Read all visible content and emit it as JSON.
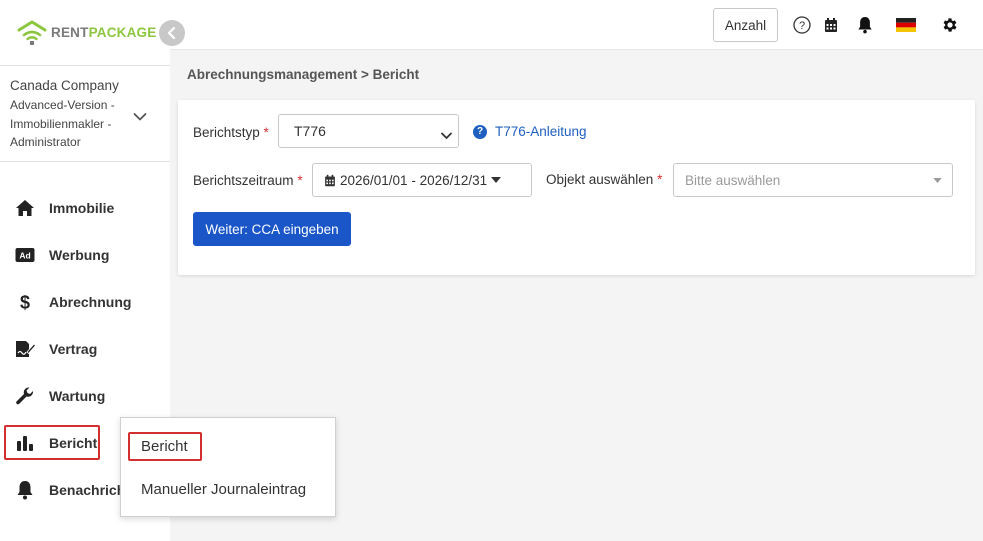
{
  "brand": {
    "rent": "RENT",
    "package": "PACKAGE",
    "accent": "#8cc63f"
  },
  "company": {
    "name": "Canada Company",
    "subtitle": "Advanced-Version - Immobilienmakler - Administrator"
  },
  "sidebar": {
    "items": [
      {
        "label": "Immobilie",
        "icon": "home-icon"
      },
      {
        "label": "Werbung",
        "icon": "ad-icon"
      },
      {
        "label": "Abrechnung",
        "icon": "dollar-icon"
      },
      {
        "label": "Vertrag",
        "icon": "contract-icon"
      },
      {
        "label": "Wartung",
        "icon": "wrench-icon"
      },
      {
        "label": "Bericht",
        "icon": "bar-chart-icon"
      },
      {
        "label": "Benachrichtigung",
        "icon": "bell-icon"
      }
    ]
  },
  "topbar": {
    "anzahl_label": "Anzahl"
  },
  "breadcrumb": "Abrechnungsmanagement > Bericht",
  "form": {
    "report_type_label": "Berichtstyp",
    "report_type_value": "T776",
    "guide_link": "T776-Anleitung",
    "period_label": "Berichtszeitraum",
    "period_value": "2026/01/01 - 2026/12/31",
    "object_label": "Objekt auswählen",
    "object_placeholder": "Bitte auswählen",
    "required_mark": "*",
    "next_button": "Weiter: CCA eingeben"
  },
  "submenu": {
    "items": [
      "Bericht",
      "Manueller Journaleintrag"
    ]
  },
  "colors": {
    "primary": "#1a56c8",
    "required": "#d32f2f",
    "link": "#1f5fbf"
  }
}
